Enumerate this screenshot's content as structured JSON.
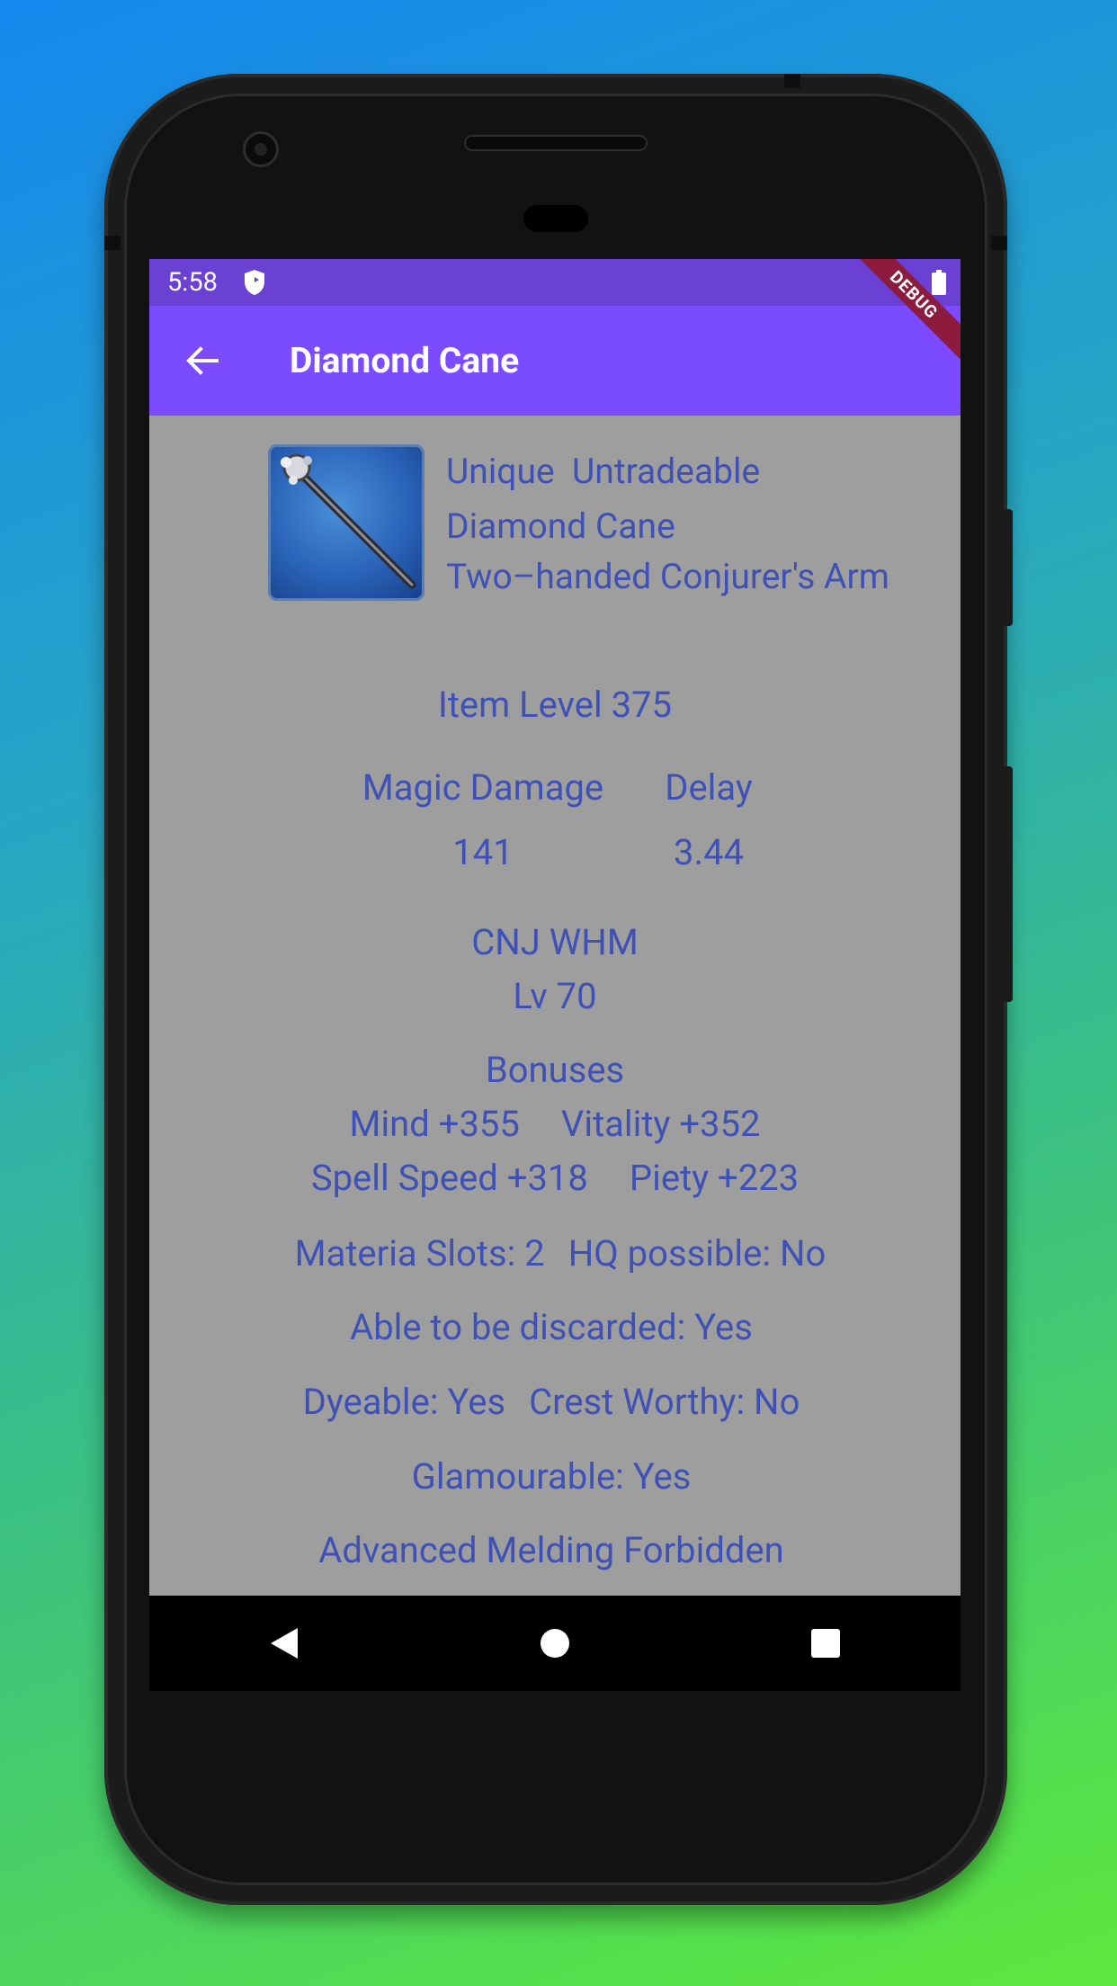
{
  "status_bar": {
    "time": "5:58"
  },
  "app_bar": {
    "title": "Diamond Cane",
    "debug_label": "DEBUG"
  },
  "item": {
    "flags": "Unique  Untradeable",
    "name": "Diamond Cane",
    "type": "Two–handed Conjurer's Arm",
    "item_level": "Item Level 375",
    "stats": {
      "col1_label": "Magic Damage",
      "col2_label": "Delay",
      "col1_value": "141",
      "col2_value": "3.44"
    },
    "classes": "CNJ WHM",
    "level": "Lv 70",
    "bonuses": {
      "heading": "Bonuses",
      "row1": [
        "Mind +355",
        "Vitality +352"
      ],
      "row2": [
        "Spell Speed +318",
        "Piety +223"
      ]
    },
    "materia": "Materia Slots: 2",
    "hq": "HQ possible: No",
    "discard": "Able to be discarded: Yes",
    "dyeable": "Dyeable: Yes",
    "crest": "Crest Worthy: No",
    "glamour": "Glamourable: Yes",
    "melding": "Advanced Melding Forbidden"
  },
  "colors": {
    "status_bar": "#6a41d2",
    "app_bar": "#7b4cff",
    "content_bg": "#9e9e9e",
    "text": "#3f51b5",
    "debug_banner": "#8d1b3d"
  },
  "icons": {
    "status": [
      "shield-icon",
      "battery-icon"
    ],
    "app_bar": [
      "back-arrow-icon"
    ],
    "navigation": [
      "nav-back-icon",
      "nav-home-icon",
      "nav-recents-icon"
    ]
  }
}
